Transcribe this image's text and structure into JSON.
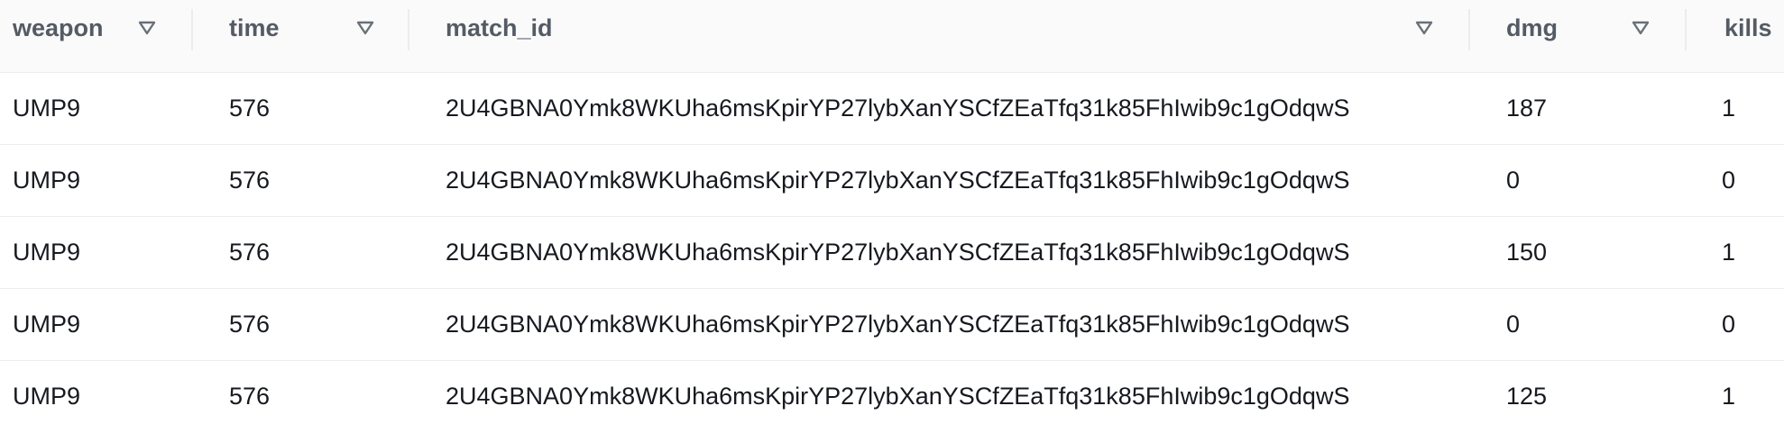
{
  "columns": [
    {
      "key": "weapon",
      "label": "weapon"
    },
    {
      "key": "time",
      "label": "time"
    },
    {
      "key": "match_id",
      "label": "match_id"
    },
    {
      "key": "dmg",
      "label": "dmg"
    },
    {
      "key": "kills",
      "label": "kills"
    }
  ],
  "sort_icon": "triangle-down-filter-icon",
  "rows": [
    {
      "weapon": "UMP9",
      "time": "576",
      "match_id": "2U4GBNA0Ymk8WKUha6msKpirYP27lybXanYSCfZEaTfq31k85FhIwib9c1gOdqwS",
      "dmg": "187",
      "kills": "1"
    },
    {
      "weapon": "UMP9",
      "time": "576",
      "match_id": "2U4GBNA0Ymk8WKUha6msKpirYP27lybXanYSCfZEaTfq31k85FhIwib9c1gOdqwS",
      "dmg": "0",
      "kills": "0"
    },
    {
      "weapon": "UMP9",
      "time": "576",
      "match_id": "2U4GBNA0Ymk8WKUha6msKpirYP27lybXanYSCfZEaTfq31k85FhIwib9c1gOdqwS",
      "dmg": "150",
      "kills": "1"
    },
    {
      "weapon": "UMP9",
      "time": "576",
      "match_id": "2U4GBNA0Ymk8WKUha6msKpirYP27lybXanYSCfZEaTfq31k85FhIwib9c1gOdqwS",
      "dmg": "0",
      "kills": "0"
    },
    {
      "weapon": "UMP9",
      "time": "576",
      "match_id": "2U4GBNA0Ymk8WKUha6msKpirYP27lybXanYSCfZEaTfq31k85FhIwib9c1gOdqwS",
      "dmg": "125",
      "kills": "1"
    }
  ]
}
